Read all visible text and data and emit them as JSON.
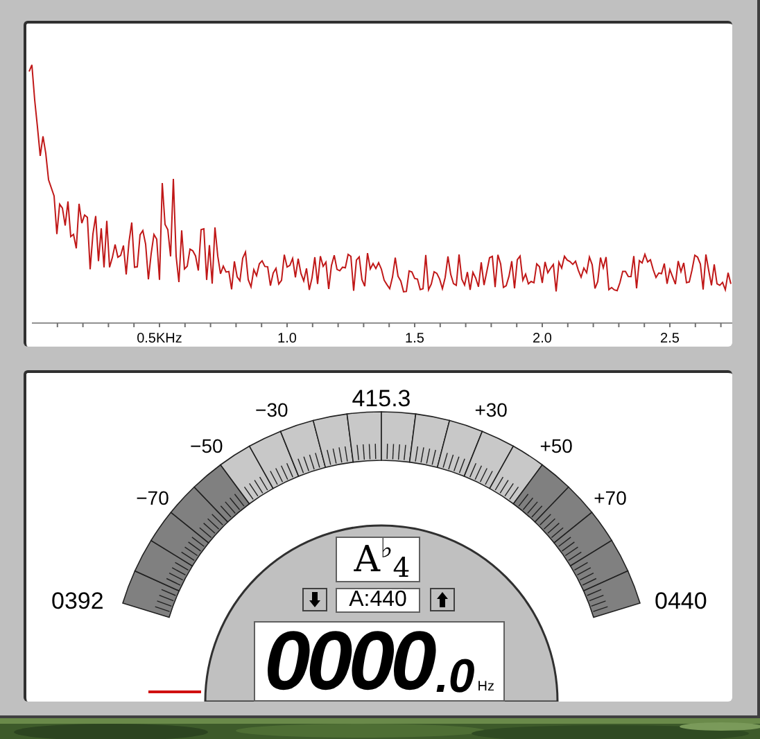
{
  "spectrum": {
    "axis_labels": [
      "0.5KHz",
      "1.0",
      "1.5",
      "2.0",
      "2.5"
    ]
  },
  "tuner": {
    "scale_labels": [
      "−70",
      "−50",
      "−30",
      "+30",
      "+50",
      "+70"
    ],
    "center_frequency": "415.3",
    "low_frequency": "0392",
    "high_frequency": "0440",
    "note": "A$^{♭}$$_{4}$",
    "reference": "A:440",
    "frequency_integer": "0000",
    "frequency_decimal": ".0",
    "unit": "Hz"
  }
}
